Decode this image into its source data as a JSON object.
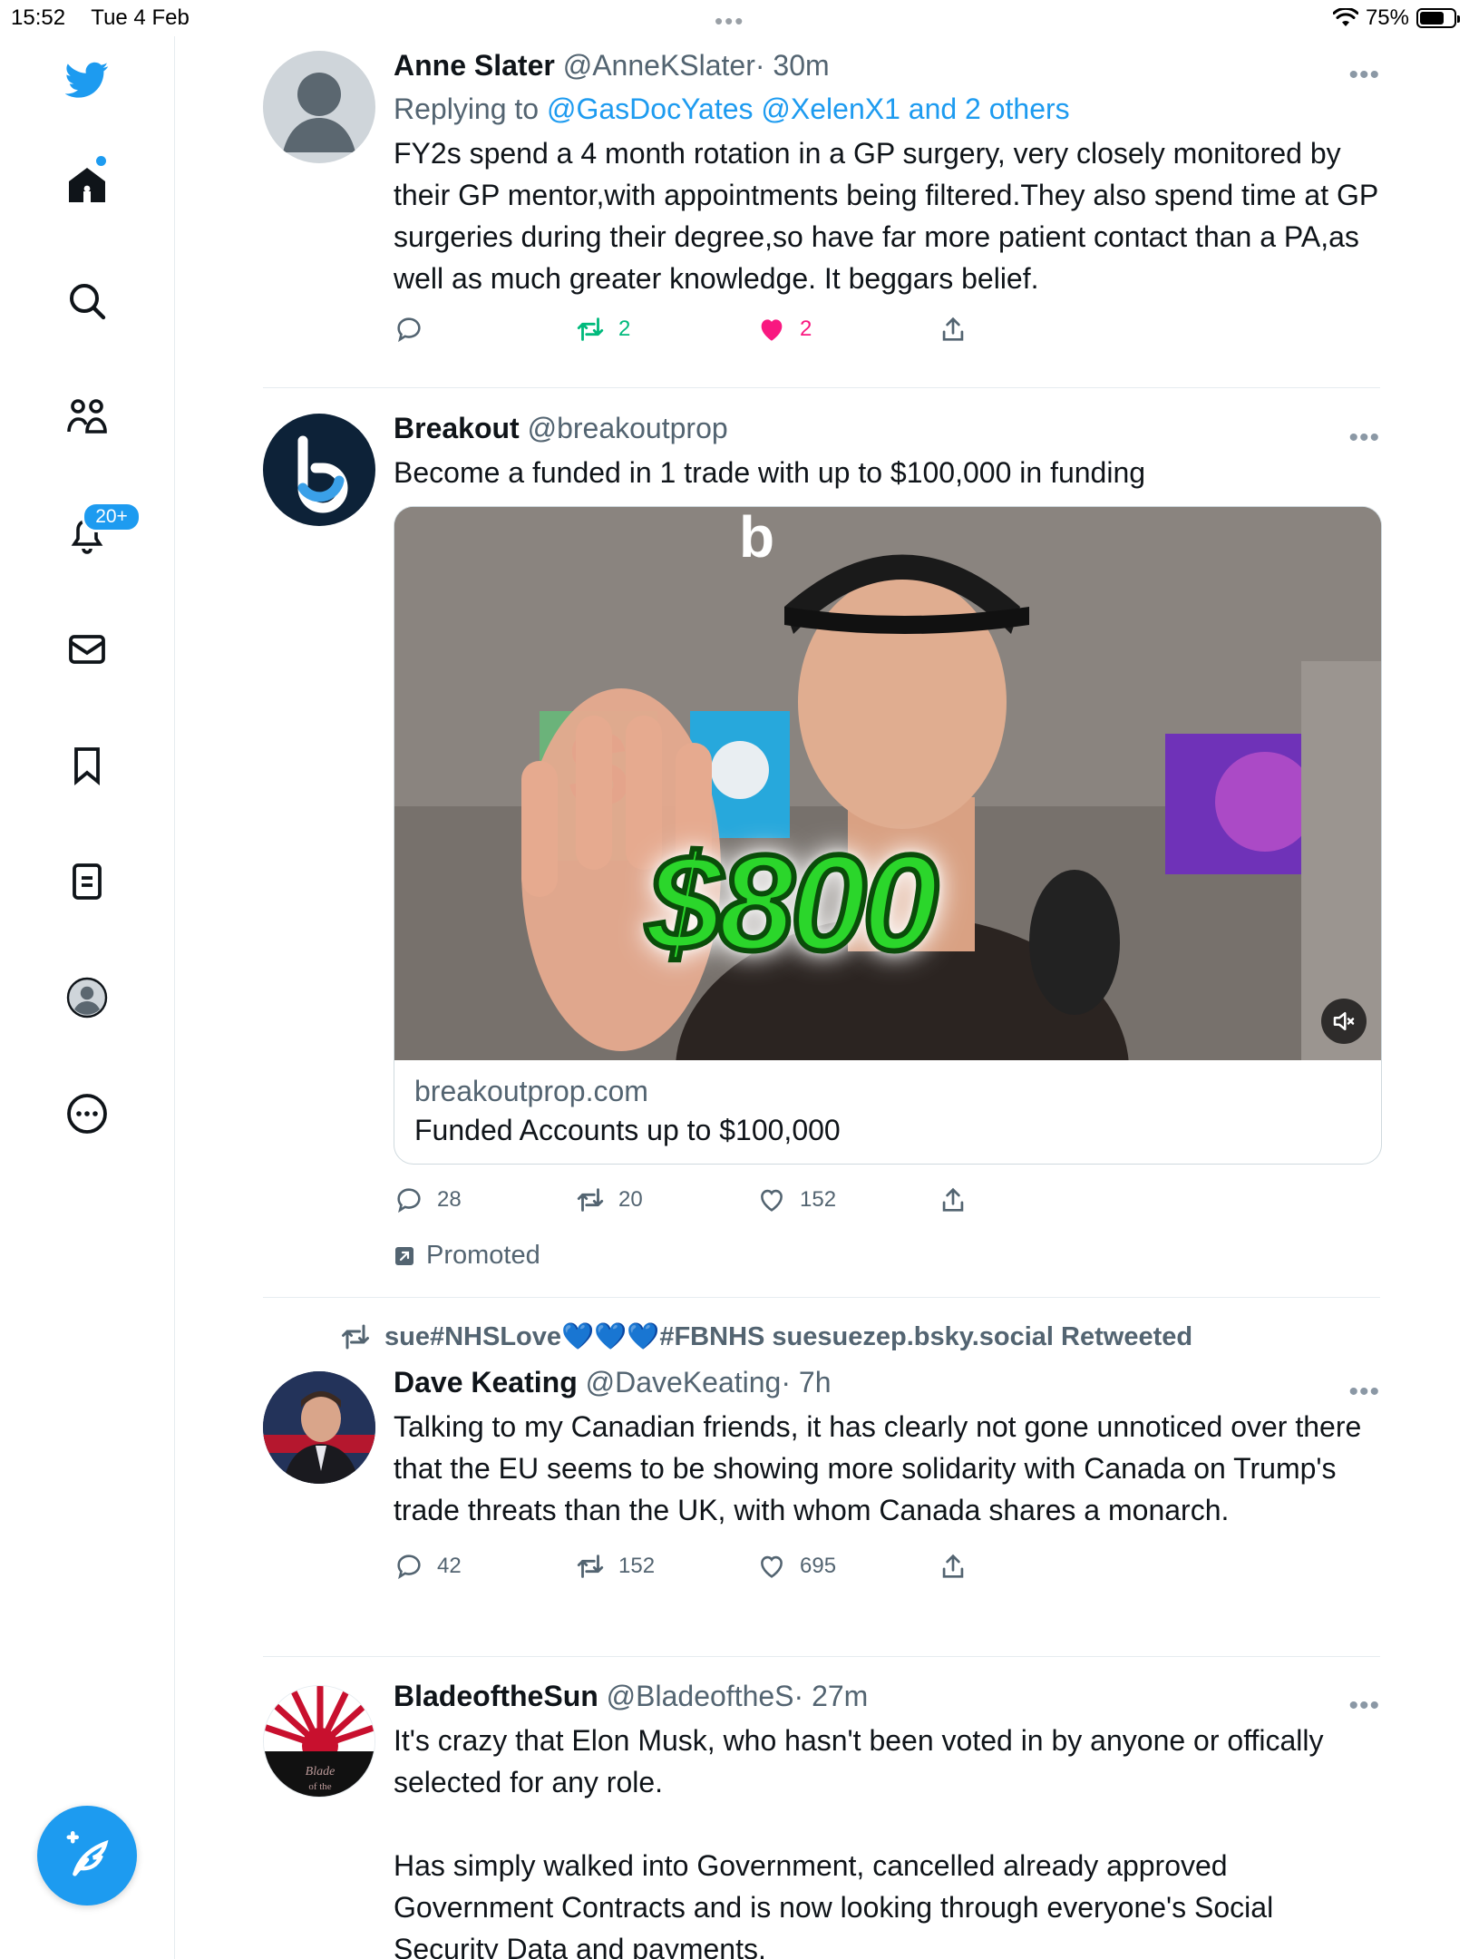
{
  "status_bar": {
    "time": "15:52",
    "date": "Tue 4 Feb",
    "dots": "•••",
    "battery": "75%",
    "battery_level": 0.75
  },
  "sidebar": {
    "items": [
      {
        "name": "twitter-logo-icon"
      },
      {
        "name": "home-icon"
      },
      {
        "name": "search-icon"
      },
      {
        "name": "communities-icon"
      },
      {
        "name": "notifications-icon",
        "badge": "20+"
      },
      {
        "name": "messages-icon"
      },
      {
        "name": "bookmarks-icon"
      },
      {
        "name": "lists-icon"
      },
      {
        "name": "profile-icon"
      },
      {
        "name": "more-icon"
      }
    ],
    "compose_icon": "compose-tweet-icon"
  },
  "colors": {
    "accent": "#1d9bf0",
    "retweet": "#00ba7c",
    "like": "#f91880",
    "muted": "#536471"
  },
  "tweets": [
    {
      "name": "Anne Slater",
      "handle": "@AnneKSlater",
      "time": "· 30m",
      "replying_prefix": "Replying to",
      "replying_to": "@GasDocYates @XelenX1 and 2 others",
      "text": "FY2s spend a 4 month rotation in a GP surgery, very closely monitored by their GP mentor,with appointments being filtered.They also spend time at GP surgeries during their degree,so have far more patient contact than a PA,as well as much greater knowledge. It beggars belief.",
      "replies": "",
      "retweets": "2",
      "likes": "2"
    },
    {
      "name": "Breakout",
      "handle": "@breakoutprop",
      "time": "",
      "text": "Become a funded in 1 trade with up to $100,000 in funding",
      "card": {
        "overlay_text": "$800",
        "domain": "breakoutprop.com",
        "title": "Funded Accounts up to $100,000"
      },
      "replies": "28",
      "retweets": "20",
      "likes": "152",
      "promoted": "Promoted"
    },
    {
      "retweeted_by": "sue#NHSLove💙💙💙#FBNHS suesuezep.bsky.social Retweeted",
      "name": "Dave Keating",
      "handle": "@DaveKeating",
      "time": "· 7h",
      "text": "Talking to my Canadian friends, it has clearly not gone unnoticed over there that the EU seems to be showing more solidarity with Canada on Trump's trade threats than the UK, with whom Canada shares a monarch.",
      "replies": "42",
      "retweets": "152",
      "likes": "695"
    },
    {
      "name": "BladeoftheSun",
      "handle": "@BladeoftheS",
      "time": "· 27m",
      "text_1": "It's crazy that Elon Musk, who hasn't been voted in by anyone or offically selected for any role.",
      "text_2": "Has simply walked into Government, cancelled already approved Government Contracts and is now looking through everyone's Social Security Data and payments."
    }
  ]
}
